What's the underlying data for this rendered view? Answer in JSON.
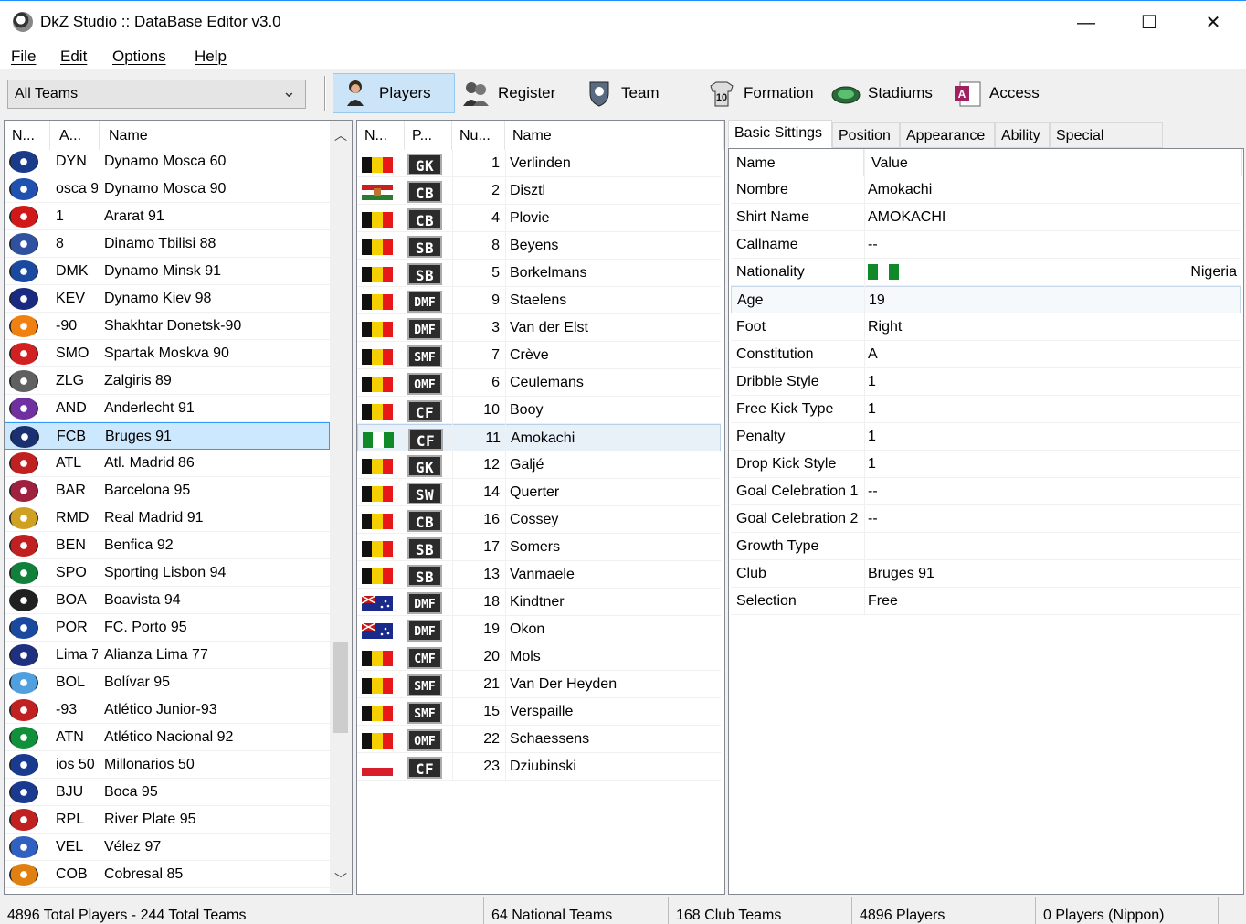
{
  "window": {
    "title": "DkZ Studio :: DataBase Editor v3.0",
    "controls": {
      "minimize": "—",
      "maximize": "☐",
      "close": "✕"
    }
  },
  "menu": [
    "File",
    "Edit",
    "Options",
    "Help"
  ],
  "toolbar": {
    "team_filter": "All Teams",
    "buttons": [
      {
        "label": "Players",
        "icon": "player-icon",
        "active": true
      },
      {
        "label": "Register",
        "icon": "register-icon",
        "active": false
      },
      {
        "label": "Team",
        "icon": "team-icon",
        "active": false
      },
      {
        "label": "Formation",
        "icon": "formation-icon",
        "active": false
      },
      {
        "label": "Stadiums",
        "icon": "stadium-icon",
        "active": false
      },
      {
        "label": "Access",
        "icon": "access-icon",
        "active": false
      }
    ]
  },
  "teams_list": {
    "headers": [
      "N...",
      "A...",
      "Name"
    ],
    "selected_index": 10,
    "rows": [
      {
        "abbr": "DYN",
        "name": "Dynamo Mosca 60",
        "crest": "#1a3a8a"
      },
      {
        "abbr": "osca 9",
        "name": "Dynamo Mosca 90",
        "crest": "#2050b0"
      },
      {
        "abbr": "1",
        "name": "Ararat 91",
        "crest": "#d01818"
      },
      {
        "abbr": "8",
        "name": "Dinamo Tbilisi 88",
        "crest": "#3050a0"
      },
      {
        "abbr": "DMK",
        "name": "Dynamo Minsk 91",
        "crest": "#1a4aa0"
      },
      {
        "abbr": "KEV",
        "name": "Dynamo Kiev 98",
        "crest": "#1a2a80"
      },
      {
        "abbr": "-90",
        "name": "Shakhtar Donetsk-90",
        "crest": "#f08010"
      },
      {
        "abbr": "SMO",
        "name": "Spartak Moskva 90",
        "crest": "#d02020"
      },
      {
        "abbr": "ZLG",
        "name": "Zalgiris 89",
        "crest": "#606060"
      },
      {
        "abbr": "AND",
        "name": "Anderlecht 91",
        "crest": "#7030a0"
      },
      {
        "abbr": "FCB",
        "name": "Bruges 91",
        "crest": "#1a3070"
      },
      {
        "abbr": "ATL",
        "name": "Atl. Madrid 86",
        "crest": "#c02020"
      },
      {
        "abbr": "BAR",
        "name": "Barcelona 95",
        "crest": "#a02040"
      },
      {
        "abbr": "RMD",
        "name": "Real Madrid 91",
        "crest": "#d0a020"
      },
      {
        "abbr": "BEN",
        "name": "Benfica 92",
        "crest": "#c02020"
      },
      {
        "abbr": "SPO",
        "name": "Sporting Lisbon 94",
        "crest": "#10803a"
      },
      {
        "abbr": "BOA",
        "name": "Boavista 94",
        "crest": "#202020"
      },
      {
        "abbr": "POR",
        "name": "FC. Porto 95",
        "crest": "#1a4aa0"
      },
      {
        "abbr": "Lima 7",
        "name": "Alianza Lima 77",
        "crest": "#203080"
      },
      {
        "abbr": "BOL",
        "name": "Bolívar 95",
        "crest": "#50a0e0"
      },
      {
        "abbr": "-93",
        "name": "Atlético Junior-93",
        "crest": "#c02020"
      },
      {
        "abbr": "ATN",
        "name": "Atlético Nacional 92",
        "crest": "#10903a"
      },
      {
        "abbr": "ios 50",
        "name": "Millonarios 50",
        "crest": "#1a3a90"
      },
      {
        "abbr": "BJU",
        "name": "Boca 95",
        "crest": "#1a3a90"
      },
      {
        "abbr": "RPL",
        "name": "River Plate 95",
        "crest": "#c02020"
      },
      {
        "abbr": "VEL",
        "name": "Vélez 97",
        "crest": "#3060c0"
      },
      {
        "abbr": "COB",
        "name": "Cobresal 85",
        "crest": "#e08010"
      }
    ]
  },
  "players_list": {
    "headers": [
      "N...",
      "P...",
      "Nu...",
      "Name"
    ],
    "selected_index": 10,
    "rows": [
      {
        "flag": "belgium",
        "pos": "GK",
        "num": "1",
        "name": "Verlinden"
      },
      {
        "flag": "hungary",
        "pos": "CB",
        "num": "2",
        "name": "Disztl"
      },
      {
        "flag": "belgium",
        "pos": "CB",
        "num": "4",
        "name": "Plovie"
      },
      {
        "flag": "belgium",
        "pos": "SB",
        "num": "8",
        "name": "Beyens"
      },
      {
        "flag": "belgium",
        "pos": "SB",
        "num": "5",
        "name": "Borkelmans"
      },
      {
        "flag": "belgium",
        "pos": "DMF",
        "num": "9",
        "name": "Staelens"
      },
      {
        "flag": "belgium",
        "pos": "DMF",
        "num": "3",
        "name": "Van der Elst"
      },
      {
        "flag": "belgium",
        "pos": "SMF",
        "num": "7",
        "name": "Crève"
      },
      {
        "flag": "belgium",
        "pos": "OMF",
        "num": "6",
        "name": "Ceulemans"
      },
      {
        "flag": "belgium",
        "pos": "CF",
        "num": "10",
        "name": "Booy"
      },
      {
        "flag": "nigeria",
        "pos": "CF",
        "num": "11",
        "name": "Amokachi"
      },
      {
        "flag": "belgium",
        "pos": "GK",
        "num": "12",
        "name": "Galjé"
      },
      {
        "flag": "belgium",
        "pos": "SW",
        "num": "14",
        "name": "Querter"
      },
      {
        "flag": "belgium",
        "pos": "CB",
        "num": "16",
        "name": "Cossey"
      },
      {
        "flag": "belgium",
        "pos": "SB",
        "num": "17",
        "name": "Somers"
      },
      {
        "flag": "belgium",
        "pos": "SB",
        "num": "13",
        "name": "Vanmaele"
      },
      {
        "flag": "australia",
        "pos": "DMF",
        "num": "18",
        "name": "Kindtner"
      },
      {
        "flag": "australia",
        "pos": "DMF",
        "num": "19",
        "name": "Okon"
      },
      {
        "flag": "belgium",
        "pos": "CMF",
        "num": "20",
        "name": "Mols"
      },
      {
        "flag": "belgium",
        "pos": "SMF",
        "num": "21",
        "name": "Van Der Heyden"
      },
      {
        "flag": "belgium",
        "pos": "SMF",
        "num": "15",
        "name": "Verspaille"
      },
      {
        "flag": "belgium",
        "pos": "OMF",
        "num": "22",
        "name": "Schaessens"
      },
      {
        "flag": "poland",
        "pos": "CF",
        "num": "23",
        "name": "Dziubinski"
      }
    ]
  },
  "details": {
    "tabs": [
      "Basic Sittings",
      "Position",
      "Appearance",
      "Ability",
      "Special Abilities"
    ],
    "active_tab": 0,
    "headers": [
      "Name",
      "Value"
    ],
    "selected_index": 4,
    "rows": [
      {
        "key": "Nombre",
        "value": "Amokachi"
      },
      {
        "key": "Shirt Name",
        "value": "AMOKACHI"
      },
      {
        "key": "Callname",
        "value": "--"
      },
      {
        "key": "Nationality",
        "value": "Nigeria",
        "flag": "nigeria"
      },
      {
        "key": "Age",
        "value": "19"
      },
      {
        "key": "Foot",
        "value": "Right"
      },
      {
        "key": "Constitution",
        "value": "A"
      },
      {
        "key": "Dribble Style",
        "value": "1"
      },
      {
        "key": "Free Kick Type",
        "value": "1"
      },
      {
        "key": "Penalty",
        "value": "1"
      },
      {
        "key": "Drop Kick Style",
        "value": "1"
      },
      {
        "key": "Goal Celebration 1",
        "value": "--"
      },
      {
        "key": "Goal Celebration 2",
        "value": "--"
      },
      {
        "key": "Growth Type",
        "value": ""
      },
      {
        "key": "Club",
        "value": "Bruges 91"
      },
      {
        "key": "Selection",
        "value": "Free"
      }
    ]
  },
  "status": [
    "4896 Total Players  -  244 Total Teams",
    "64 National Teams",
    "168 Club Teams",
    "4896 Players",
    "0 Players (Nippon)"
  ],
  "colors": {
    "selection": "#cce8ff",
    "selection_border": "#3399ff",
    "pos_gk": "#1e8f3e",
    "pos_def": "#2aa84c"
  }
}
